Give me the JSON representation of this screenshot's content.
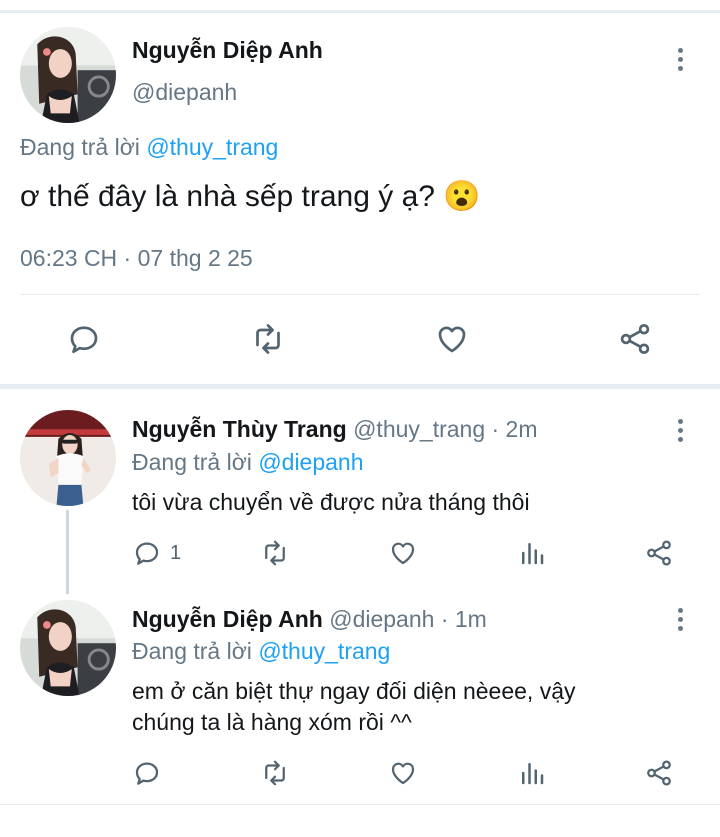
{
  "main_tweet": {
    "author_name": "Nguyễn Diệp Anh",
    "handle": "@diepanh",
    "reply_prefix": "Đang trả lời",
    "reply_to": "@thuy_trang",
    "text": "ơ thế đây là nhà sếp trang ý ạ?",
    "emoji": "😮",
    "timestamp": "06:23 CH · 07 thg 2 25"
  },
  "replies": [
    {
      "author_name": "Nguyễn Thùy Trang",
      "meta": "@thuy_trang · 2m",
      "reply_prefix": "Đang trả lời",
      "reply_to": "@diepanh",
      "text": "tôi vừa chuyển về được nửa tháng thôi",
      "reply_count": "1"
    },
    {
      "author_name": "Nguyễn Diệp Anh",
      "meta": "@diepanh · 1m",
      "reply_prefix": "Đang trả lời",
      "reply_to": "@thuy_trang",
      "text_line1": "em ở căn biệt thự ngay đối diện nèeee, vậy",
      "text_line2": "chúng ta là hàng xóm rồi ^^"
    }
  ],
  "icons": [
    "reply-icon",
    "retweet-icon",
    "like-icon",
    "analytics-icon",
    "share-icon",
    "more-icon"
  ],
  "colors": {
    "link": "#1da1f2",
    "muted": "#657786",
    "divider": "#e6ecf0"
  }
}
